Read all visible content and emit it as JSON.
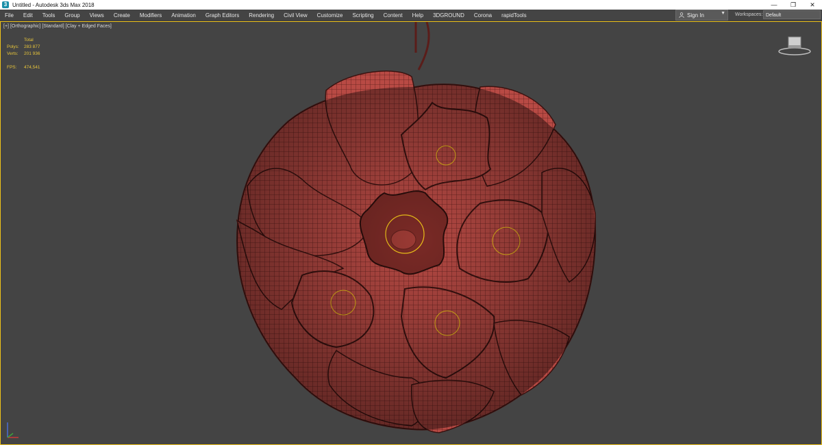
{
  "window": {
    "title": "Untitled - Autodesk 3ds Max 2018",
    "controls": [
      "—",
      "❐",
      "✕"
    ]
  },
  "menu": [
    "File",
    "Edit",
    "Tools",
    "Group",
    "Views",
    "Create",
    "Modifiers",
    "Animation",
    "Graph Editors",
    "Rendering",
    "Civil View",
    "Customize",
    "Scripting",
    "Content",
    "Help",
    "3DGROUND",
    "Corona",
    "rapidTools"
  ],
  "account": {
    "signin_label": "Sign In"
  },
  "workspaces": {
    "label": "Workspaces:",
    "value": "Default"
  },
  "viewport": {
    "label_plus": "[+]",
    "label_view": "[Orthographic]",
    "label_shading": "[Standard]",
    "label_mode": "[Clay + Edged Faces]",
    "stats": {
      "header": "Total",
      "polys_label": "Polys:",
      "polys_value": "283 877",
      "verts_label": "Verts:",
      "verts_value": "201 936",
      "fps_label": "FPS:",
      "fps_value": "474,541"
    }
  },
  "colors": {
    "accent_selection": "#f0c419",
    "mesh_fill": "#b84a44",
    "viewport_bg": "#444444"
  }
}
